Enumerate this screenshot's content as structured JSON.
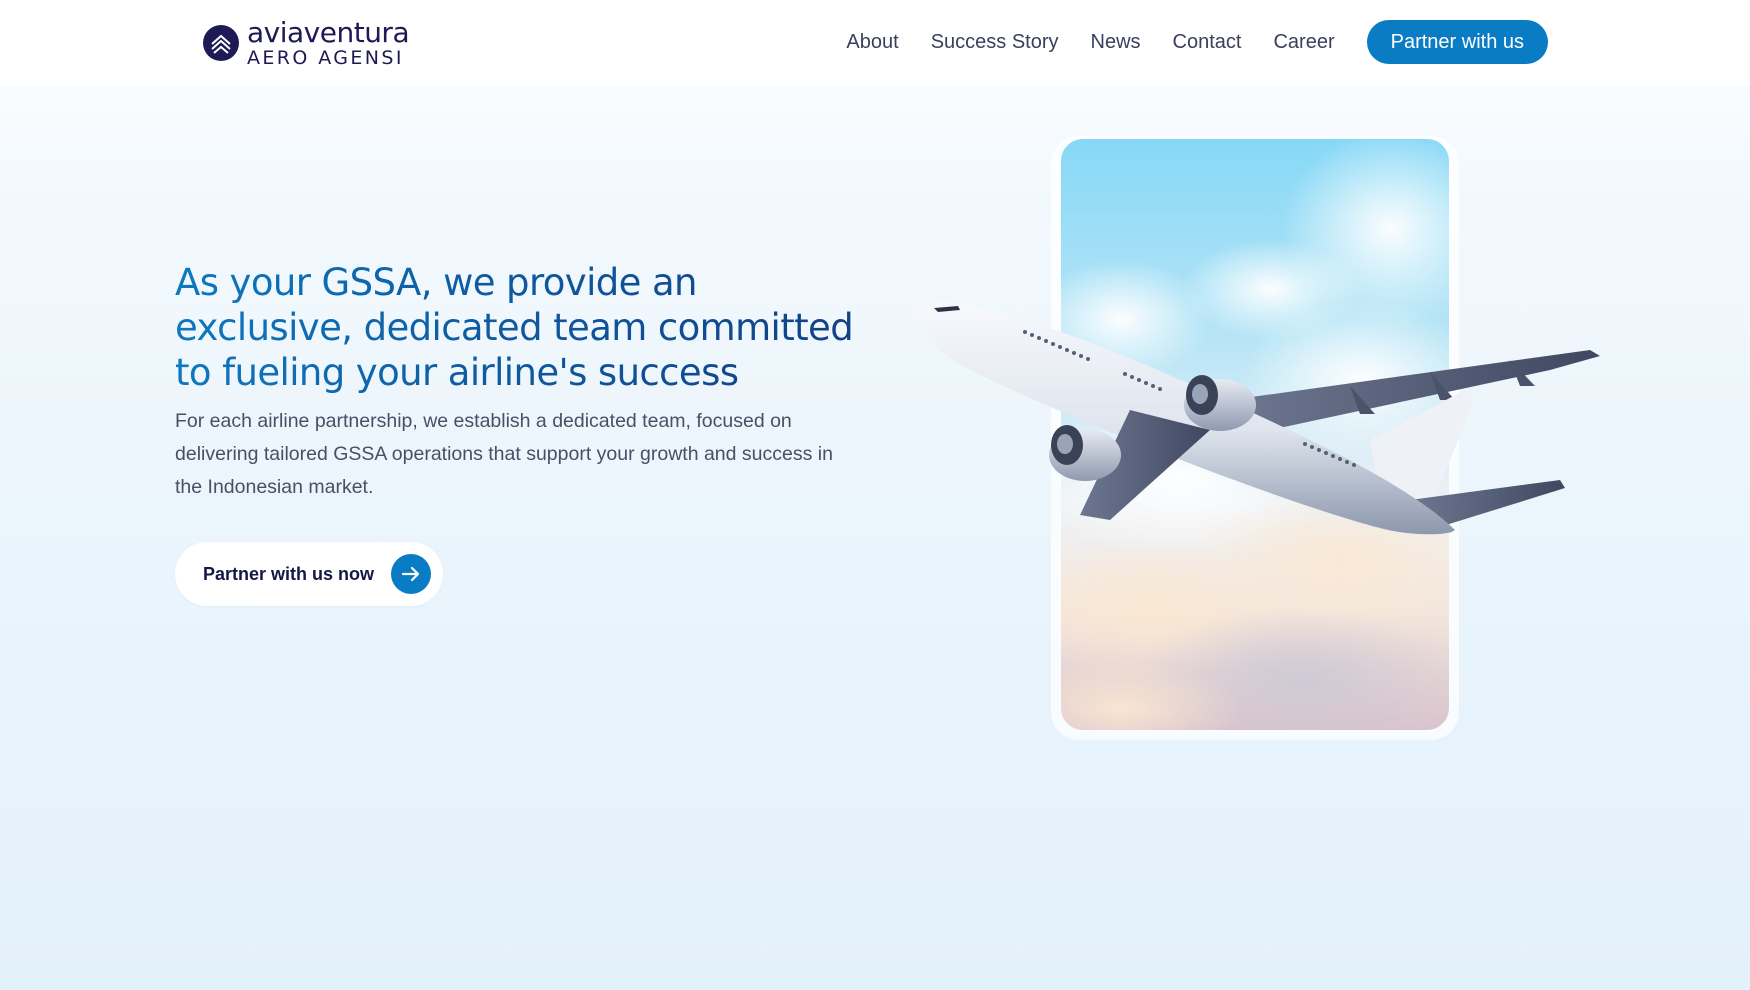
{
  "brand": {
    "name": "aviaventura",
    "subname": "AERO AGENSI",
    "icon": "chevron-up-logo-icon",
    "color": "#1d1a55"
  },
  "nav": {
    "links": [
      "About",
      "Success Story",
      "News",
      "Contact",
      "Career"
    ],
    "cta": "Partner with us"
  },
  "hero": {
    "title": "As your GSSA, we provide an exclusive, dedicated team committed to fueling your airline's success",
    "description": "For each airline partnership, we establish a dedicated team, focused on delivering tailored GSSA operations that support your growth and success in the Indonesian market.",
    "cta": "Partner with us now",
    "cta_icon": "arrow-right-icon"
  },
  "visual": {
    "image": "airplane-in-sky-photo",
    "accent_color": "#0a7cc4"
  }
}
